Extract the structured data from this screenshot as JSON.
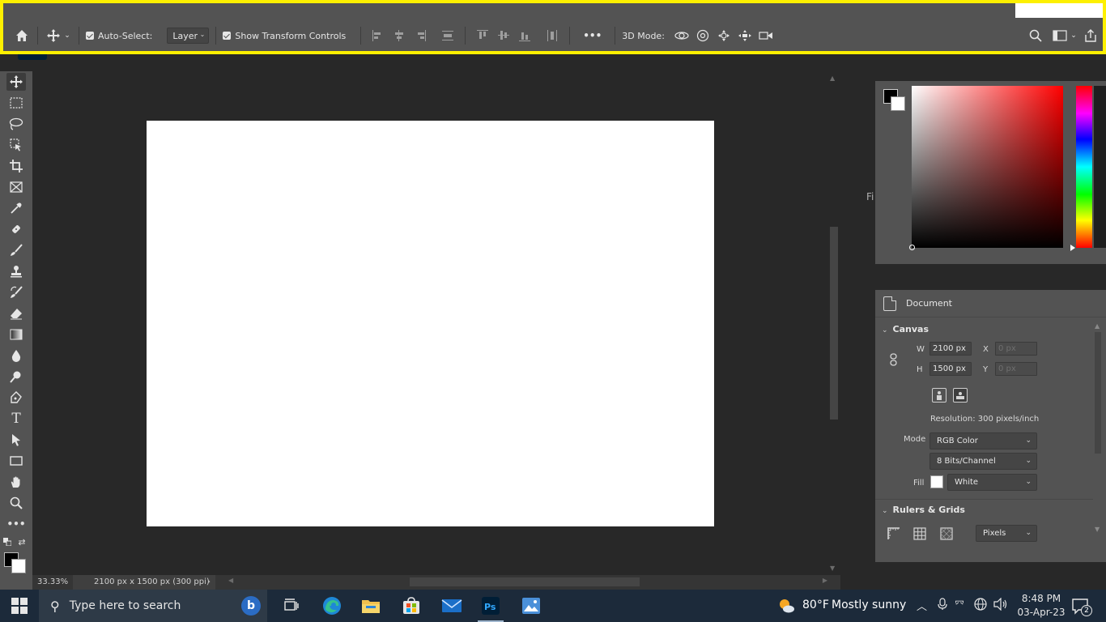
{
  "options_bar": {
    "auto_select_label": "Auto-Select:",
    "auto_select_value": "Layer",
    "show_transform_label": "Show Transform Controls",
    "mode_3d_label": "3D Mode:",
    "more_label": "•••"
  },
  "status_bar": {
    "zoom": "33.33%",
    "doc_info": "2100 px x 1500 px (300 ppi)"
  },
  "side_text": {
    "fi": "Fi"
  },
  "properties": {
    "header_label": "Document",
    "canvas_section": "Canvas",
    "w_label": "W",
    "w_value": "2100 px",
    "h_label": "H",
    "h_value": "1500 px",
    "x_label": "X",
    "x_placeholder": "0 px",
    "y_label": "Y",
    "y_placeholder": "0 px",
    "resolution": "Resolution: 300 pixels/inch",
    "mode_label": "Mode",
    "mode_value": "RGB Color",
    "bits_value": "8 Bits/Channel",
    "fill_label": "Fill",
    "fill_value": "White",
    "rulers_section": "Rulers & Grids",
    "units_value": "Pixels"
  },
  "taskbar": {
    "search_placeholder": "Type here to search",
    "weather_temp": "80°F",
    "weather_desc": "Mostly sunny",
    "time": "8:48 PM",
    "date": "03-Apr-23",
    "notification_count": "2"
  },
  "colors": {
    "accent_frame": "#fdf000",
    "panel_bg": "#535353",
    "canvas_bg": "#282828",
    "taskbar_bg": "#1c2a3a"
  }
}
